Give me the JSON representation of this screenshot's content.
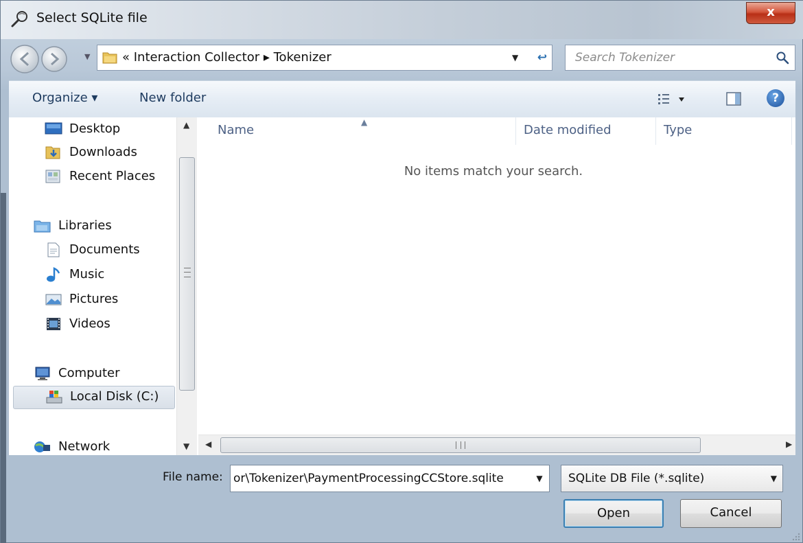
{
  "window": {
    "title": "Select SQLite file",
    "close_label": "x"
  },
  "address_bar": {
    "path": "« Interaction Collector ▸ Tokenizer",
    "dropdown": "▼"
  },
  "search": {
    "placeholder": "Search Tokenizer"
  },
  "toolbar": {
    "organize_label": "Organize ▾",
    "new_folder_label": "New folder",
    "help_label": "?"
  },
  "nav_pane": {
    "items": [
      {
        "label": "Desktop",
        "icon": "desktop-icon"
      },
      {
        "label": "Downloads",
        "icon": "downloads-icon"
      },
      {
        "label": "Recent Places",
        "icon": "recent-places-icon"
      },
      {
        "label": "Libraries",
        "icon": "libraries-icon"
      },
      {
        "label": "Documents",
        "icon": "documents-icon"
      },
      {
        "label": "Music",
        "icon": "music-icon"
      },
      {
        "label": "Pictures",
        "icon": "pictures-icon"
      },
      {
        "label": "Videos",
        "icon": "videos-icon"
      },
      {
        "label": "Computer",
        "icon": "computer-icon"
      },
      {
        "label": "Local Disk (C:)",
        "icon": "local-disk-icon",
        "selected": true
      },
      {
        "label": "Network",
        "icon": "network-icon"
      }
    ]
  },
  "file_list": {
    "columns": [
      "Name",
      "Date modified",
      "Type"
    ],
    "empty_message": "No items match your search.",
    "hscroll_grip": "III"
  },
  "bottom": {
    "file_name_label": "File name:",
    "file_name_value": "or\\Tokenizer\\PaymentProcessingCCStore.sqlite",
    "file_type_value": "SQLite DB File (*.sqlite)",
    "open_label": "Open",
    "cancel_label": "Cancel"
  },
  "colors": {
    "accent": "#3c7fb1",
    "close_button": "#c63d22",
    "column_header_text": "#4d6185"
  }
}
